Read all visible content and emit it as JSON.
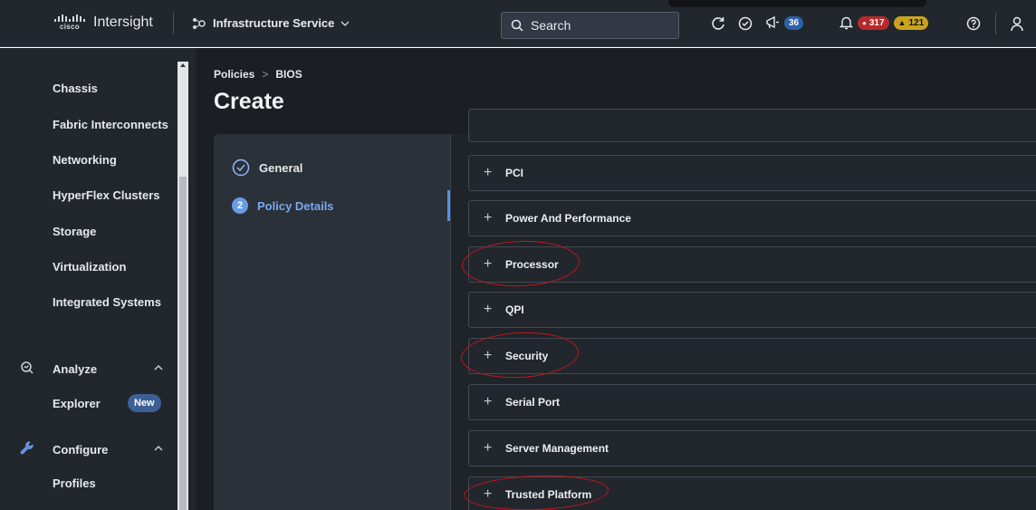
{
  "topbar": {
    "brand_logo_text": "cisco",
    "app_name": "Intersight",
    "service": "Infrastructure Service",
    "search_label": "Search",
    "announcements_count": "36",
    "alarm_critical_count": "317",
    "alarm_warning_count": "121"
  },
  "sidebar": {
    "items": [
      "Chassis",
      "Fabric Interconnects",
      "Networking",
      "HyperFlex Clusters",
      "Storage",
      "Virtualization",
      "Integrated Systems"
    ],
    "analyze": {
      "label": "Analyze",
      "explorer": "Explorer",
      "new_badge": "New"
    },
    "configure": {
      "label": "Configure",
      "profiles": "Profiles"
    }
  },
  "page": {
    "breadcrumb": [
      "Policies",
      "BIOS"
    ],
    "title": "Create"
  },
  "wizard": {
    "steps": [
      {
        "label": "General",
        "state": "done"
      },
      {
        "label": "Policy Details",
        "number": "2",
        "state": "active"
      }
    ]
  },
  "accordion": {
    "sections": [
      "PCI",
      "Power And Performance",
      "Processor",
      "QPI",
      "Security",
      "Serial Port",
      "Server Management",
      "Trusted Platform"
    ],
    "highlighted": [
      "Processor",
      "Security",
      "Trusted Platform"
    ]
  },
  "colors": {
    "accent": "#6a9be8",
    "highlight_circle": "#c4161c",
    "critical": "#b42a2a",
    "warning": "#c9a320"
  }
}
